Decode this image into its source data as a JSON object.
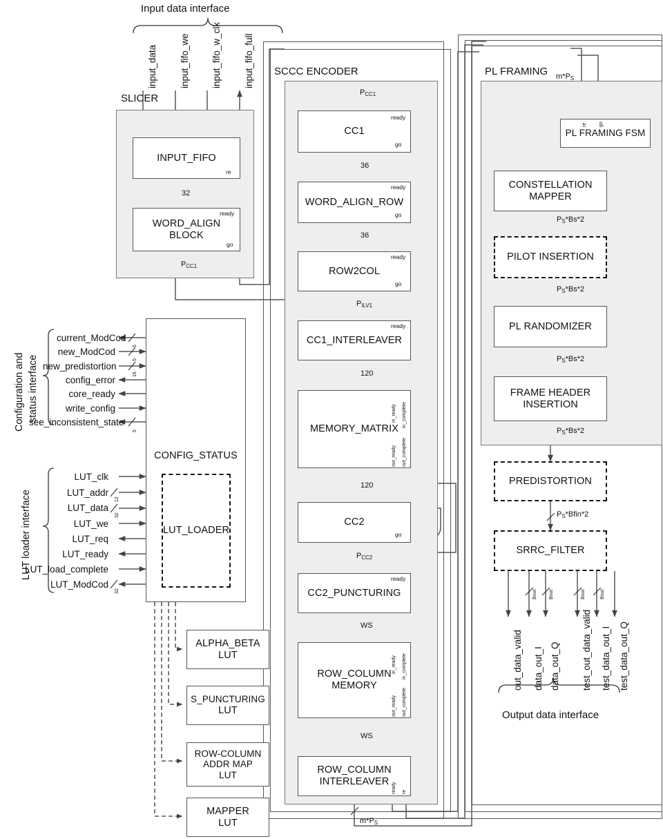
{
  "interfaces": {
    "input": "Input data interface",
    "output": "Output data interface",
    "config": "Configuration and\nstatus interface",
    "config_line1": "Configuration and",
    "config_line2": "status interface",
    "lut": "LUT loader interface"
  },
  "input_signals": [
    {
      "name": "input_data",
      "dir": "in",
      "width": "32"
    },
    {
      "name": "input_fifo_we",
      "dir": "in",
      "width": ""
    },
    {
      "name": "input_fifo_w_clk",
      "dir": "in",
      "width": ""
    },
    {
      "name": "input_fifo_full",
      "dir": "out",
      "width": ""
    }
  ],
  "output_signals": [
    {
      "name": "out_data_valid",
      "width": ""
    },
    {
      "name": "data_out_I",
      "width": "Bout"
    },
    {
      "name": "data_out_Q",
      "width": "Bout"
    },
    {
      "name": "test_out_data_valid",
      "width": ""
    },
    {
      "name": "test_data_out_I",
      "width": "Bout"
    },
    {
      "name": "test_data_out_Q",
      "width": "Bout"
    }
  ],
  "config_signals": [
    {
      "name": "current_ModCod",
      "dir": "out",
      "width": "5"
    },
    {
      "name": "new_ModCod",
      "dir": "in",
      "width": "5"
    },
    {
      "name": "new_predistortion",
      "dir": "in",
      "width": "16"
    },
    {
      "name": "config_error",
      "dir": "out",
      "width": ""
    },
    {
      "name": "core_ready",
      "dir": "out",
      "width": ""
    },
    {
      "name": "write_config",
      "dir": "in",
      "width": ""
    },
    {
      "name": "see_inconsistent_state",
      "dir": "out",
      "width": "5"
    }
  ],
  "lut_signals": [
    {
      "name": "LUT_clk",
      "dir": "in",
      "width": ""
    },
    {
      "name": "LUT_addr",
      "dir": "in",
      "width": "12"
    },
    {
      "name": "LUT_data",
      "dir": "in",
      "width": "32"
    },
    {
      "name": "LUT_we",
      "dir": "in",
      "width": ""
    },
    {
      "name": "LUT_req",
      "dir": "out",
      "width": ""
    },
    {
      "name": "LUT_ready",
      "dir": "out",
      "width": ""
    },
    {
      "name": "LUT_load_complete",
      "dir": "in",
      "width": ""
    },
    {
      "name": "LUT_ModCod",
      "dir": "out",
      "width": "32"
    }
  ],
  "regions": {
    "slicer": "SLICER",
    "sccc": "SCCC ENCODER",
    "plframing": "PL FRAMING"
  },
  "blocks": {
    "input_fifo": "INPUT_FIFO",
    "word_align_block_l1": "WORD_ALIGN",
    "word_align_block_l2": "BLOCK",
    "config_status": "CONFIG_STATUS",
    "lut_loader": "LUT_LOADER",
    "alpha_beta_l1": "ALPHA_BETA",
    "alpha_beta_l2": "LUT",
    "s_punct_l1": "S_PUNCTURING",
    "s_punct_l2": "LUT",
    "rowcol_addr_l1": "ROW-COLUMN",
    "rowcol_addr_l2": "ADDR MAP",
    "rowcol_addr_l3": "LUT",
    "mapper_l1": "MAPPER",
    "mapper_l2": "LUT",
    "cc1": "CC1",
    "word_align_row": "WORD_ALIGN_ROW",
    "row2col": "ROW2COL",
    "cc1_interleaver": "CC1_INTERLEAVER",
    "memory_matrix": "MEMORY_MATRIX",
    "cc2": "CC2",
    "cc2_puncturing": "CC2_PUNCTURING",
    "row_column_memory_l1": "ROW_COLUMN",
    "row_column_memory_l2": "MEMORY",
    "row_column_interleaver_l1": "ROW_COLUMN",
    "row_column_interleaver_l2": "INTERLEAVER",
    "pl_framing_fsm": "PL FRAMING FSM",
    "constellation_mapper_l1": "CONSTELLATION",
    "constellation_mapper_l2": "MAPPER",
    "pilot_insertion": "PILOT INSERTION",
    "pl_randomizer": "PL RANDOMIZER",
    "frame_header_l1": "FRAME HEADER",
    "frame_header_l2": "INSERTION",
    "predistortion": "PREDISTORTION",
    "srrc_filter": "SRRC_FILTER"
  },
  "handshake": {
    "ready": "ready",
    "go": "go",
    "re": "re",
    "in_ready": "in_ready",
    "in_complete": "in_complete",
    "out_ready": "out_ready",
    "out_complete": "out_complete"
  },
  "bus_labels": {
    "w32_a": "32",
    "w32_b": "32",
    "p_cc1_slicer": "PCC1",
    "p_cc1_sccc": "PCC1",
    "w36_a": "36",
    "w36_b": "36",
    "p_ilv1": "PILV1",
    "w120_a": "120",
    "w120_b": "120",
    "p_cc2": "PCC2",
    "ws_a": "WS",
    "ws_b": "WS",
    "m_ps_bottom": "m*PS",
    "m_ps_top": "m*PS",
    "ps_bs2_a": "PS*Bs*2",
    "ps_bs2_b": "PS*Bs*2",
    "ps_bs2_c": "PS*Bs*2",
    "ps_bs2_d": "PS*Bs*2",
    "ps_bfin2": "PS*Bfin*2"
  },
  "colors": {
    "region_fill": "#eeeeee",
    "block_border": "#555555",
    "dashed_border": "#111111",
    "wire": "#555555",
    "text": "#111111"
  }
}
